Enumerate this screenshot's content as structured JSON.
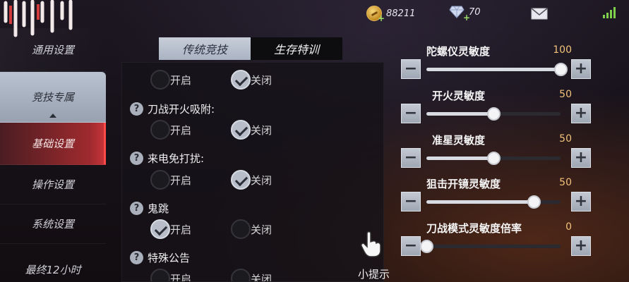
{
  "topbar": {
    "coins": "88211",
    "diamonds": "70"
  },
  "sidebar": {
    "items": [
      {
        "label": "通用设置"
      },
      {
        "label": "竞技专属"
      },
      {
        "label": "基础设置"
      },
      {
        "label": "操作设置"
      },
      {
        "label": "系统设置"
      },
      {
        "label": "最终12小时"
      }
    ]
  },
  "tabs": [
    {
      "label": "传统竞技",
      "selected": true
    },
    {
      "label": "生存特训",
      "selected": false
    }
  ],
  "options": [
    {
      "title": "",
      "on_label": "开启",
      "off_label": "关闭",
      "selected": "off"
    },
    {
      "title": "刀战开火吸附:",
      "on_label": "开启",
      "off_label": "关闭",
      "selected": "off"
    },
    {
      "title": "来电免打扰:",
      "on_label": "开启",
      "off_label": "关闭",
      "selected": "off"
    },
    {
      "title": "鬼跳",
      "on_label": "开启",
      "off_label": "关闭",
      "selected": "on"
    },
    {
      "title": "特殊公告",
      "on_label": "开启",
      "off_label": "关闭",
      "selected": "none"
    }
  ],
  "sliders": [
    {
      "label": "陀螺仪灵敏度",
      "value": "100",
      "level": 100
    },
    {
      "label": "开火灵敏度",
      "value": "50",
      "level": 50
    },
    {
      "label": "准星灵敏度",
      "value": "50",
      "level": 50
    },
    {
      "label": "狙击开镜灵敏度",
      "value": "50",
      "level": 80
    },
    {
      "label": "刀战模式灵敏度倍率",
      "value": "0",
      "level": 0
    }
  ],
  "hint": {
    "label": "小提示"
  },
  "colors": {
    "accent_red": "#c9353a",
    "value_gold": "#f2c27a"
  }
}
